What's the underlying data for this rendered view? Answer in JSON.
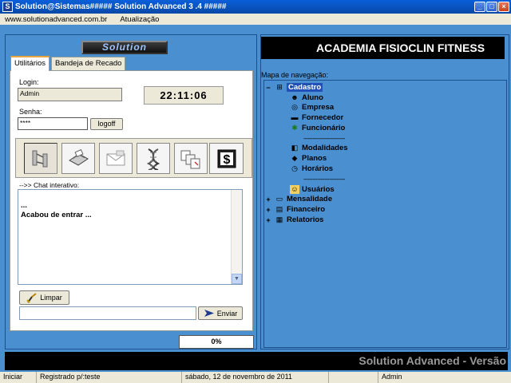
{
  "window": {
    "title": "Solution@Sistemas##### Solution Advanced 3 .4 #####"
  },
  "menu": {
    "url": "www.solutionadvanced.com.br",
    "item": "Atualização"
  },
  "logo_text": "Solution",
  "tabs": [
    "Utilitários",
    "Bandeja de Recado"
  ],
  "login": {
    "label": "Login:",
    "value": "Admin",
    "password_label": "Senha:",
    "password_value": "****",
    "logoff_label": "logoff"
  },
  "clock": "22:11:06",
  "tools": [
    "transfer-icon",
    "printer-icon",
    "mail-icon",
    "dna-icon",
    "copy-icon",
    "dollar-icon"
  ],
  "chat": {
    "label": "-->> Chat interativo:",
    "lines": [
      "...",
      "Acabou de entrar ..."
    ],
    "clear_label": "Limpar",
    "send_label": "Enviar",
    "input_value": ""
  },
  "progress": "0%",
  "banner": "ACADEMIA FISIOCLIN FITNESS",
  "nav": {
    "label": "Mapa de navegação:",
    "root": "Cadastro",
    "items": [
      "Aluno",
      "Empresa",
      "Fornecedor",
      "Funcionário"
    ],
    "separator": "------------------------",
    "items2": [
      "Modalidades",
      "Planos",
      "Horários"
    ],
    "items3": [
      "Usuários"
    ],
    "groups": [
      "Mensalidade",
      "Financeiro",
      "Relatorios"
    ]
  },
  "footer_banner": "Solution Advanced - Versão",
  "status": {
    "start": "Iniciar",
    "registered": "Registrado p/:teste",
    "date": "sábado, 12 de novembro de 2011",
    "empty": "",
    "user": "Admin"
  }
}
